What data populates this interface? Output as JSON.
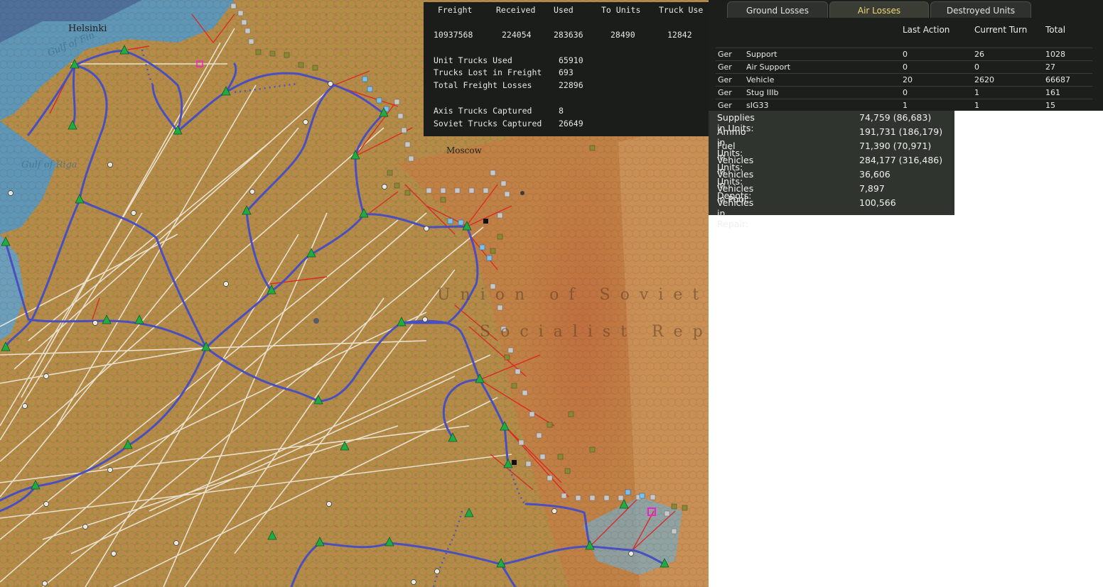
{
  "map": {
    "labels": {
      "helsinki": "Helsinki",
      "moscow": "Moscow",
      "gulf_fin": "Gulf of Fin",
      "gulf_riga": "Gulf of Riga",
      "country_line1": "Union of Soviet",
      "country_line2": "Socialist Repu"
    }
  },
  "freight": {
    "headers": [
      "Freight",
      "Received",
      "Used",
      "To Units",
      "Truck Use"
    ],
    "values": [
      "10937568",
      "224054",
      "283636",
      "28490",
      "12842"
    ],
    "stats": [
      {
        "label": "Unit Trucks Used",
        "value": "65910"
      },
      {
        "label": "Trucks Lost in Freight",
        "value": "693"
      },
      {
        "label": "Total Freight Losses",
        "value": "22896"
      },
      {
        "label": "Axis Trucks Captured",
        "value": "8"
      },
      {
        "label": "Soviet Trucks Captured",
        "value": "26649"
      }
    ]
  },
  "losses": {
    "tabs": [
      "Ground Losses",
      "Air Losses",
      "Destroyed Units"
    ],
    "columns": [
      "Last Action",
      "Current Turn",
      "Total"
    ],
    "rows": [
      {
        "side": "Ger",
        "type": "Support",
        "last": "0",
        "turn": "26",
        "total": "1028"
      },
      {
        "side": "Ger",
        "type": "Air Support",
        "last": "0",
        "turn": "0",
        "total": "27"
      },
      {
        "side": "Ger",
        "type": "Vehicle",
        "last": "20",
        "turn": "2620",
        "total": "66687"
      },
      {
        "side": "Ger",
        "type": "Stug IIIb",
        "last": "0",
        "turn": "1",
        "total": "161"
      },
      {
        "side": "Ger",
        "type": "sIG33",
        "last": "1",
        "turn": "1",
        "total": "15"
      }
    ]
  },
  "supply": [
    {
      "label": "Supplies in Units:",
      "value": "74,759 (86,683)"
    },
    {
      "label": "Ammo in Units:",
      "value": "191,731 (186,179)"
    },
    {
      "label": "Fuel in Units:",
      "value": "71,390 (70,971)"
    },
    {
      "label": "Vehicles in Units:",
      "value": "284,177 (316,486)"
    },
    {
      "label": "Vehicles in Depots:",
      "value": "36,606"
    },
    {
      "label": "Vehicles in Pool:",
      "value": "7,897"
    },
    {
      "label": "Vehicles in Repair:",
      "value": "100,566"
    }
  ],
  "colors": {
    "rail": "#4a4fc0",
    "supply_line": "#e02020",
    "freight_line": "#f4f1e6",
    "depot": "#22aa44",
    "tab_active": "#f1d77a"
  }
}
